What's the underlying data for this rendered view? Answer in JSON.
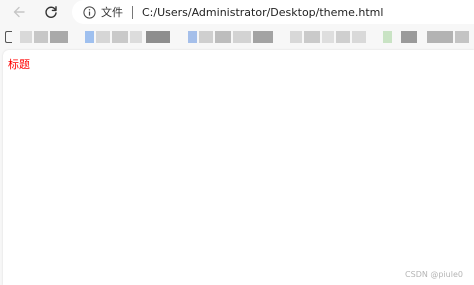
{
  "toolbar": {
    "back_icon": "arrow-left-icon",
    "reload_icon": "reload-icon",
    "info_icon": "info-icon",
    "scheme_label": "文件",
    "url": "C:/Users/Administrator/Desktop/theme.html"
  },
  "bookmarks": {
    "folder_icon": "folder-icon"
  },
  "page": {
    "heading": "标题",
    "heading_color": "#ff0000"
  },
  "watermark": "CSDN @piule0"
}
